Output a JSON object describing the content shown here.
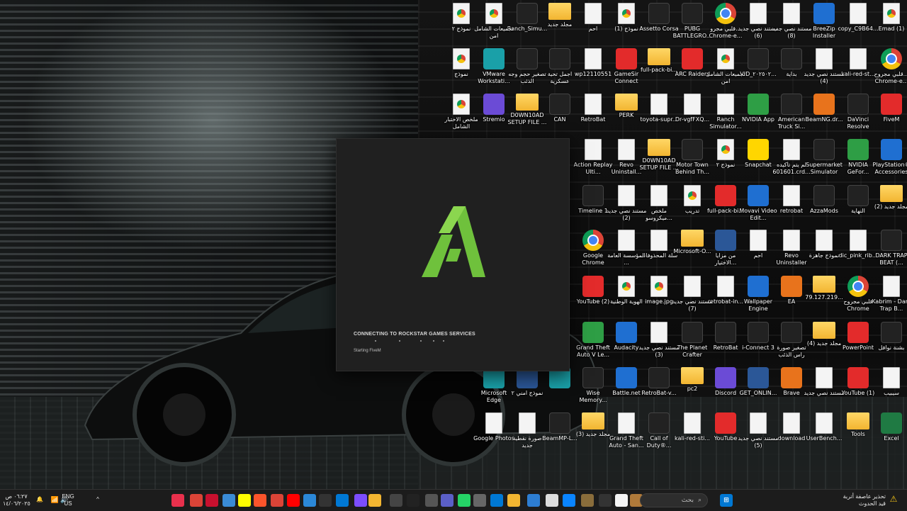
{
  "fivem": {
    "status": "CONNECTING TO ROCKSTAR GAMES SERVICES",
    "substatus": "Starting FiveM"
  },
  "desktop_icons": [
    {
      "label": "Emad (1)",
      "icon": "chromedoc"
    },
    {
      "label": "copy_C9B64...",
      "icon": "doc"
    },
    {
      "label": "BreeZip Installer",
      "icon": "blue"
    },
    {
      "label": "مستند نصي جديد (8)",
      "icon": "doc"
    },
    {
      "label": "مستند نصي جديد (6)",
      "icon": "doc"
    },
    {
      "label": "قلبي مجرو... Chrome-e...",
      "icon": "chrome"
    },
    {
      "label": "PUBG BATTLEGRO...",
      "icon": "dark"
    },
    {
      "label": "Assetto Corsa",
      "icon": "dark"
    },
    {
      "label": "نموذج (1)",
      "icon": "chromedoc"
    },
    {
      "label": "احم",
      "icon": "doc"
    },
    {
      "label": "مجلد جديد",
      "icon": "folder"
    },
    {
      "label": "Ranch_Simu...",
      "icon": "dark"
    },
    {
      "label": "تجميعات الشامل امن",
      "icon": "chromedoc"
    },
    {
      "label": "نموذج ٢",
      "icon": "chromedoc"
    },
    {
      "label": "قلبي مجروح... Chrome-e...",
      "icon": "chrome"
    },
    {
      "label": "kali-red-st...",
      "icon": "doc"
    },
    {
      "label": "مستند نصي جديد (4)",
      "icon": "doc"
    },
    {
      "label": "بداية",
      "icon": "dark"
    },
    {
      "label": "VID_٢٠٢٥٠٢...",
      "icon": "dark"
    },
    {
      "label": "تجميعات الشامل امن",
      "icon": "chromedoc"
    },
    {
      "label": "ARC Raiders",
      "icon": "red"
    },
    {
      "label": "full-pack-bi...",
      "icon": "folder"
    },
    {
      "label": "GameSir Connect",
      "icon": "red"
    },
    {
      "label": "wp12110551",
      "icon": "doc"
    },
    {
      "label": "اجمل تحية عسكرية",
      "icon": "dark"
    },
    {
      "label": "تصغير حجم وجه الذئب",
      "icon": "dark"
    },
    {
      "label": "VMware Workstati...",
      "icon": "teal"
    },
    {
      "label": "نموذج",
      "icon": "chromedoc"
    },
    {
      "label": "FiveM",
      "icon": "red"
    },
    {
      "label": "DaVinci Resolve",
      "icon": "dark"
    },
    {
      "label": "BeamNG.dr...",
      "icon": "orange"
    },
    {
      "label": "American Truck Si...",
      "icon": "dark"
    },
    {
      "label": "NVIDIA App",
      "icon": "green"
    },
    {
      "label": "Ranch Simulator...",
      "icon": "doc"
    },
    {
      "label": "Dr-vgfFXQ...",
      "icon": "doc"
    },
    {
      "label": "toyota-supr...",
      "icon": "doc"
    },
    {
      "label": "PERK",
      "icon": "folder"
    },
    {
      "label": "RetroBat",
      "icon": "doc"
    },
    {
      "label": "CAN",
      "icon": "dark"
    },
    {
      "label": "D0WN10AD SETUP FILE ...",
      "icon": "folder"
    },
    {
      "label": "Stremio",
      "icon": "purple"
    },
    {
      "label": "ملخص الاختبار الشامل",
      "icon": "chromedoc"
    },
    {
      "label": "PlayStation® Accessories",
      "icon": "blue"
    },
    {
      "label": "NVIDIA GeFor...",
      "icon": "green"
    },
    {
      "label": "Supermarket Simulator",
      "icon": "dark"
    },
    {
      "label": "لم يتم تأكيده 601601.crd...",
      "icon": "doc"
    },
    {
      "label": "Snapchat",
      "icon": "yellow"
    },
    {
      "label": "نموذج ٢",
      "icon": "chromedoc"
    },
    {
      "label": "Motor Town Behind Th...",
      "icon": "dark"
    },
    {
      "label": "D0WN10AD SETUP FILE ...",
      "icon": "folder"
    },
    {
      "label": "Revo Uninstall...",
      "icon": "doc"
    },
    {
      "label": "Action Replay Ulti...",
      "icon": "doc"
    },
    {
      "label": "مجلد جديد (2)",
      "icon": "folder"
    },
    {
      "label": "النهاية",
      "icon": "dark"
    },
    {
      "label": "AzzaMods",
      "icon": "dark"
    },
    {
      "label": "retrobat",
      "icon": "doc"
    },
    {
      "label": "Movavi Video Edit...",
      "icon": "blue"
    },
    {
      "label": "full-pack-bi...",
      "icon": "red"
    },
    {
      "label": "تدريب",
      "icon": "chromedoc"
    },
    {
      "label": "ملخص ميكروسو...",
      "icon": "doc"
    },
    {
      "label": "مستند نصي جديد (2)",
      "icon": "doc"
    },
    {
      "label": "Timeline 1",
      "icon": "dark"
    },
    {
      "label": "DARK TRAP BEAT (...",
      "icon": "dark"
    },
    {
      "label": "dic_pink_rib...",
      "icon": "doc"
    },
    {
      "label": "نموذج جاهزة",
      "icon": "doc"
    },
    {
      "label": "Revo Uninstaller",
      "icon": "doc"
    },
    {
      "label": "احم",
      "icon": "doc"
    },
    {
      "label": "من مزايا الاختيار...",
      "icon": "word"
    },
    {
      "label": "Microsoft-O...",
      "icon": "folder"
    },
    {
      "label": "سلة المحذوفات",
      "icon": "doc"
    },
    {
      "label": "المؤسسة العامة ...",
      "icon": "doc"
    },
    {
      "label": "Google Chrome",
      "icon": "chrome"
    },
    {
      "label": "Kabrim - Dark Trap B...",
      "icon": "doc"
    },
    {
      "label": "قلبي مجروح Chrome",
      "icon": "chrome"
    },
    {
      "label": "79.127.219...",
      "icon": "folder"
    },
    {
      "label": "EA",
      "icon": "orange"
    },
    {
      "label": "Wallpaper Engine",
      "icon": "blue"
    },
    {
      "label": "retrobat-in...",
      "icon": "doc"
    },
    {
      "label": "مستند نصي جديد (7)",
      "icon": "doc"
    },
    {
      "label": "image.jpg",
      "icon": "chromedoc"
    },
    {
      "label": "الهوية الوطنية",
      "icon": "chromedoc"
    },
    {
      "label": "YouTube (2)",
      "icon": "red"
    },
    {
      "label": "بشنة نوافل",
      "icon": "dark"
    },
    {
      "label": "PowerPoint",
      "icon": "red"
    },
    {
      "label": "مجلد جديد (4)",
      "icon": "folder"
    },
    {
      "label": "تصغير صورة راس الذئب",
      "icon": "dark"
    },
    {
      "label": "i-Connect 3",
      "icon": "dark"
    },
    {
      "label": "RetroBat",
      "icon": "dark"
    },
    {
      "label": "The Planet Crafter",
      "icon": "dark"
    },
    {
      "label": "مستند نصي جديد (3)",
      "icon": "doc"
    },
    {
      "label": "Audacity",
      "icon": "blue"
    },
    {
      "label": "Grand Theft Auto V Le...",
      "icon": "green"
    },
    {
      "label": "سيبيب",
      "icon": "doc"
    },
    {
      "label": "YouTube (1)",
      "icon": "red"
    },
    {
      "label": "مستند نصي جديد",
      "icon": "doc"
    },
    {
      "label": "Brave",
      "icon": "orange"
    },
    {
      "label": "GET_ONLIN...",
      "icon": "word"
    },
    {
      "label": "Discord",
      "icon": "purple"
    },
    {
      "label": "pc2",
      "icon": "folder"
    },
    {
      "label": "RetroBat-v...",
      "icon": "dark"
    },
    {
      "label": "Battle.net",
      "icon": "blue"
    },
    {
      "label": "Wise Memory...",
      "icon": "dark"
    },
    {
      "label": "",
      "icon": "teal"
    },
    {
      "label": "نموذج امني ٢",
      "icon": "word"
    },
    {
      "label": "Microsoft Edge",
      "icon": "teal"
    },
    {
      "label": "Excel",
      "icon": "excel"
    },
    {
      "label": "Tools",
      "icon": "folder"
    },
    {
      "label": "UserBench...",
      "icon": "doc"
    },
    {
      "label": "download",
      "icon": "doc"
    },
    {
      "label": "مستند نصي جديد (5)",
      "icon": "doc"
    },
    {
      "label": "YouTube",
      "icon": "red"
    },
    {
      "label": "kali-red-sti...",
      "icon": "doc"
    },
    {
      "label": "Call of Duty®...",
      "icon": "dark"
    },
    {
      "label": "Grand Theft Auto - San...",
      "icon": "doc"
    },
    {
      "label": "مجلد جديد (3)",
      "icon": "folder"
    },
    {
      "label": "BeamMP-L...",
      "icon": "dark"
    },
    {
      "label": "صورة نقطية جديد",
      "icon": "doc"
    },
    {
      "label": "Google Photos",
      "icon": "doc"
    }
  ],
  "taskbar": {
    "search_placeholder": "بحث",
    "lang_top": "ENG",
    "lang_bottom": "US",
    "time": "٠٦:٢٧ ص",
    "date": "١٤/٠٦/٢٠٢٥",
    "weather_title": "تحذير عاصفة أتربة",
    "weather_sub": "قيد الحدوث",
    "apps": [
      "FiveM",
      "Chrome",
      "Opera",
      "Settings",
      "Snapchat",
      "Brave",
      "Chrome",
      "YouTube",
      "Security",
      "G Hub",
      "Outlook",
      "VPN",
      "Folder",
      "Terminal",
      "Media",
      "ES",
      "Teams",
      "WhatsApp",
      "Tools",
      "Mail",
      "Explorer",
      "Store",
      "Notepad",
      "Photos",
      "Widgets"
    ]
  }
}
